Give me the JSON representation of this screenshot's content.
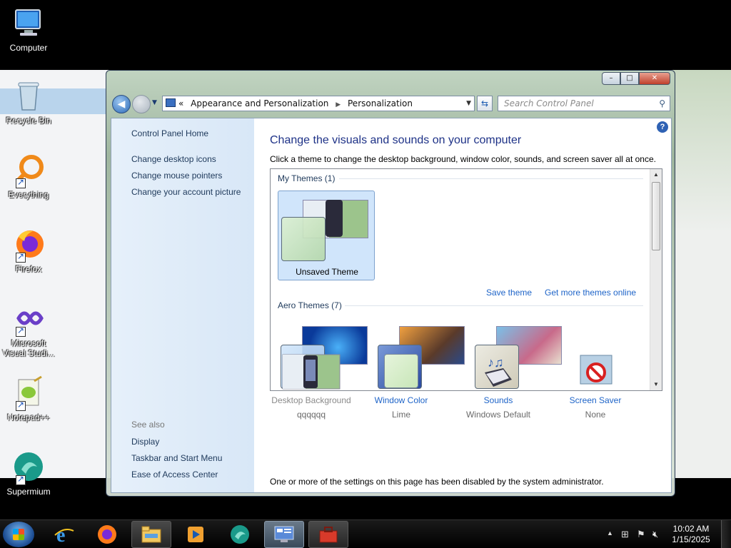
{
  "desktop": {
    "icons": [
      {
        "label": "Computer"
      },
      {
        "label": "Recycle Bin"
      },
      {
        "label": "Everything"
      },
      {
        "label": "Firefox"
      },
      {
        "label": "Microsoft Visual Studi..."
      },
      {
        "label": "Notepad++"
      },
      {
        "label": "Supermium"
      }
    ]
  },
  "window": {
    "controls": {
      "minimize": "–",
      "maximize": "□",
      "close": "✕"
    },
    "address": {
      "prefix": "«",
      "crumb1": "Appearance and Personalization",
      "crumb2": "Personalization"
    },
    "search": {
      "placeholder": "Search Control Panel"
    },
    "left_pane": {
      "home": "Control Panel Home",
      "links": [
        "Change desktop icons",
        "Change mouse pointers",
        "Change your account picture"
      ],
      "see_also_label": "See also",
      "see_also": [
        "Display",
        "Taskbar and Start Menu",
        "Ease of Access Center"
      ]
    },
    "main": {
      "title": "Change the visuals and sounds on your computer",
      "subtitle": "Click a theme to change the desktop background, window color, sounds, and screen saver all at once.",
      "my_themes_label": "My Themes (1)",
      "unsaved_theme": "Unsaved Theme",
      "save_theme": "Save theme",
      "get_more": "Get more themes online",
      "aero_themes_label": "Aero Themes (7)",
      "bottom": [
        {
          "label": "Desktop Background",
          "value": "qqqqqq",
          "enabled": false
        },
        {
          "label": "Window Color",
          "value": "Lime",
          "enabled": true
        },
        {
          "label": "Sounds",
          "value": "Windows Default",
          "enabled": true
        },
        {
          "label": "Screen Saver",
          "value": "None",
          "enabled": true
        }
      ],
      "disabled_note": "One or more of the settings on this page has been disabled by the system administrator."
    }
  },
  "taskbar": {
    "clock_time": "10:02 AM",
    "clock_date": "1/15/2025"
  },
  "colors": {
    "link": "#1e64c8",
    "title": "#1e3287",
    "selected_tile": "#d0e5fb",
    "window_color_lime": "#c8e6b8"
  }
}
